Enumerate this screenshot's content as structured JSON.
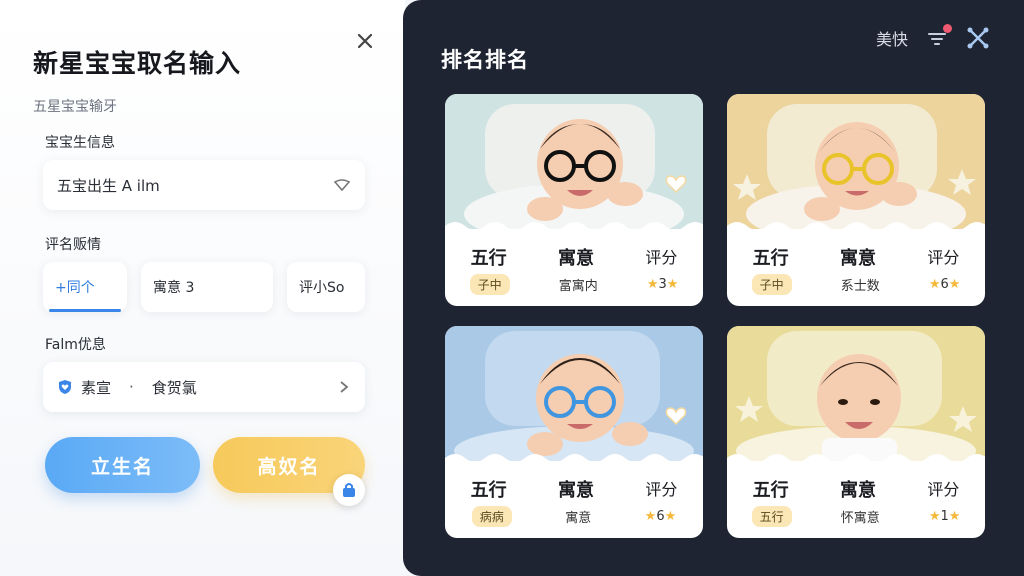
{
  "left": {
    "title": "新星宝宝取名输入",
    "subtitle": "五星宝宝输牙",
    "section1_label": "宝宝生信息",
    "field1_value": "五宝出生 A ilm",
    "section2_label": "评名贩情",
    "chips": [
      "+同个",
      "寓意 3",
      "评小So"
    ],
    "section3_label": "Falm优息",
    "field2_left": "素宣",
    "field2_dot": "·",
    "field2_right": "食贺氯",
    "btn_primary": "立生名",
    "btn_secondary": "高奴名"
  },
  "right": {
    "title": "排名排名",
    "top_text": "美快",
    "cards": [
      {
        "h1": "五行",
        "h2": "寓意",
        "h3": "评分",
        "v1": "子中",
        "v2": "富寓内",
        "v3": "3"
      },
      {
        "h1": "五行",
        "h2": "寓意",
        "h3": "评分",
        "v1": "子中",
        "v2": "系士数",
        "v3": "6"
      },
      {
        "h1": "五行",
        "h2": "寓意",
        "h3": "评分",
        "v1": "病病",
        "v2": "寓意",
        "v3": "6"
      },
      {
        "h1": "五行",
        "h2": "寓意",
        "h3": "评分",
        "v1": "五行",
        "v2": "怀寓意",
        "v3": "1"
      }
    ]
  },
  "colors": {
    "accent_blue": "#5aa9f5",
    "accent_yellow": "#f6c95a",
    "dark_panel": "#1f2432",
    "star": "#f4b93a"
  },
  "icons": [
    "close-icon",
    "chevron-down-icon",
    "heart-shield-icon",
    "lock-icon",
    "filter-icon",
    "expand-icon",
    "star-icon",
    "heart-icon"
  ]
}
